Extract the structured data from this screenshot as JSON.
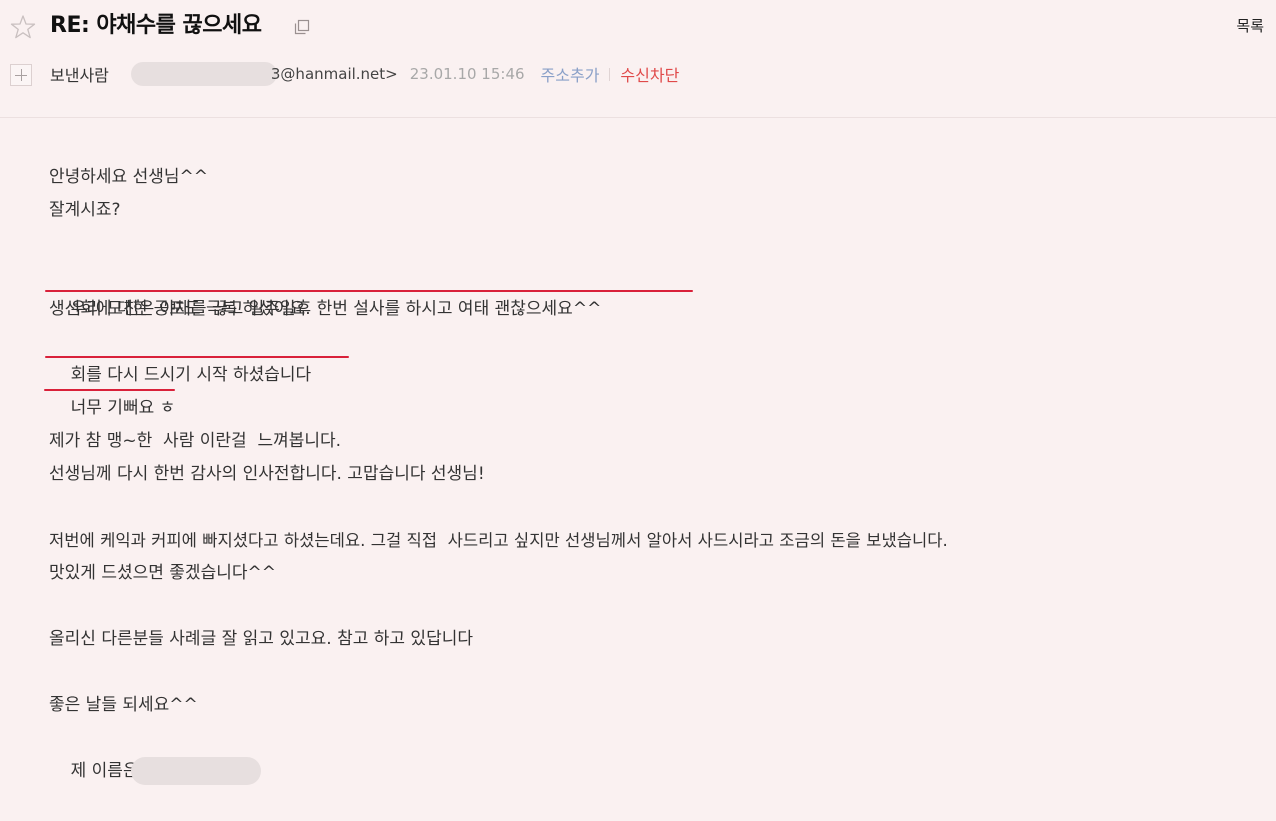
{
  "header": {
    "subject": "RE: 야채수를 끊으세요",
    "list_link": "목록",
    "sender_label": "보낸사람",
    "sender_address_suffix": "3@hanmail.net>",
    "date": "23.01.10 15:46",
    "add_address": "주소추가",
    "block_sender": "수신차단"
  },
  "body": {
    "lines": [
      "안녕하세요 선생님^^",
      "잘계시죠?",
      "",
      "우리 모친은 야채를 끊고 일주일후 한번 설사를 하시고 여태 괜찮으세요^^",
      "생선회에 대한 공포도 극복 하셨어요.",
      "회를 다시 드시기 시작 하셨습니다",
      "너무 기뻐요 ㅎ",
      "",
      "제가 참 맹~한  사람 이란걸  느껴봅니다.",
      "선생님께 다시 한번 감사의 인사전합니다. 고맙습니다 선생님!",
      "",
      "저번에 케익과 커피에 빠지셨다고 하셨는데요. 그걸 직접  사드리고 싶지만 선생님께서 알아서 사드시라고 조금의 돈을 보냈습니다.",
      "맛있게 드셨으면 좋겠습니다^^",
      "",
      "올리신 다른분들 사례글 잘 읽고 있고요. 참고 하고 있답니다",
      "",
      "좋은 날들 되세요^^"
    ],
    "signature_prefix": "제 이름은"
  },
  "colors": {
    "background": "#faf1f1",
    "underline": "#d9213a",
    "block_sender": "#e04a4a",
    "add_address": "#8aa0c8",
    "date": "#a8a8a8"
  }
}
